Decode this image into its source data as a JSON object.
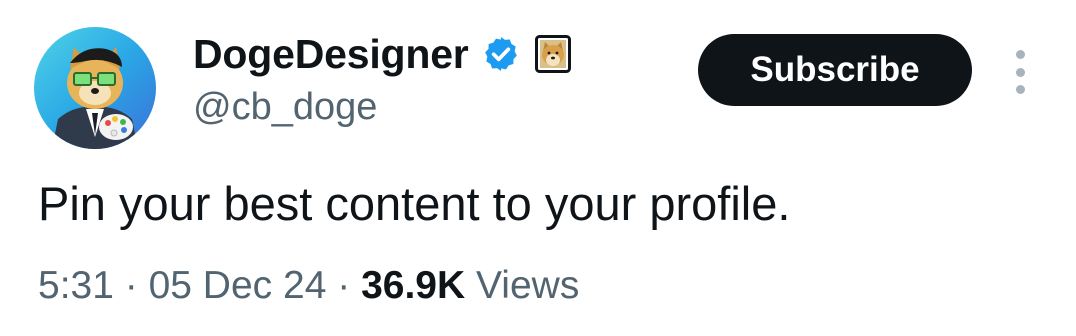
{
  "author": {
    "display_name": "DogeDesigner",
    "handle": "@cb_doge",
    "verified_color": "#1d9bf0"
  },
  "actions": {
    "subscribe_label": "Subscribe",
    "more_icon": "vertical-ellipsis-icon"
  },
  "post": {
    "text": "Pin your best content to your profile.",
    "time": "5:31",
    "separator": "·",
    "date": "05 Dec 24",
    "views_count": "36.9K",
    "views_label": "Views"
  },
  "colors": {
    "text_primary": "#0f1419",
    "text_secondary": "#536471",
    "button_bg": "#0f1419",
    "button_text": "#ffffff"
  }
}
